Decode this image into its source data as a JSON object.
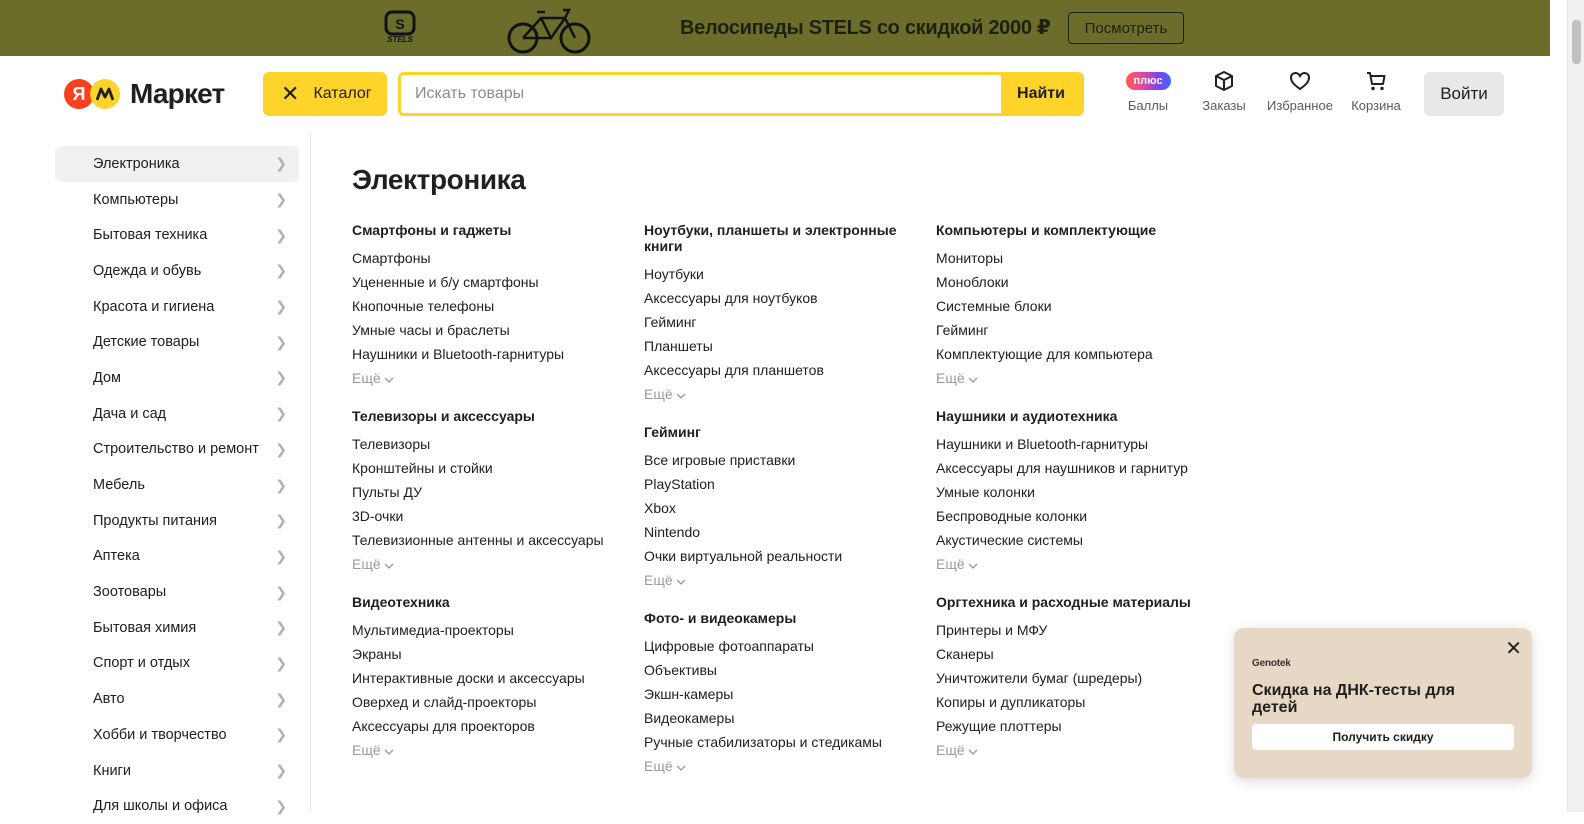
{
  "banner": {
    "brand": "STELS",
    "text": "Велосипеды STELS со скидкой 2000 ₽",
    "button": "Посмотреть",
    "background": "#6b6e2b"
  },
  "header": {
    "logo_text": "Маркет",
    "logo_letter": "Я",
    "catalog_button": "Каталог",
    "search_placeholder": "Искать товары",
    "search_button": "Найти",
    "icons": [
      {
        "badge": "плюс",
        "label": "Баллы",
        "icon": "plus-badge"
      },
      {
        "label": "Заказы",
        "icon": "box-icon"
      },
      {
        "label": "Избранное",
        "icon": "heart-icon"
      },
      {
        "label": "Корзина",
        "icon": "cart-icon"
      }
    ],
    "login_button": "Войти",
    "accent": "#fed42b"
  },
  "sidebar": {
    "items": [
      {
        "label": "Электроника"
      },
      {
        "label": "Компьютеры"
      },
      {
        "label": "Бытовая техника"
      },
      {
        "label": "Одежда и обувь"
      },
      {
        "label": "Красота и гигиена"
      },
      {
        "label": "Детские товары"
      },
      {
        "label": "Дом"
      },
      {
        "label": "Дача и сад"
      },
      {
        "label": "Строительство и ремонт"
      },
      {
        "label": "Мебель"
      },
      {
        "label": "Продукты питания"
      },
      {
        "label": "Аптека"
      },
      {
        "label": "Зоотовары"
      },
      {
        "label": "Бытовая химия"
      },
      {
        "label": "Спорт и отдых"
      },
      {
        "label": "Авто"
      },
      {
        "label": "Хобби и творчество"
      },
      {
        "label": "Книги"
      },
      {
        "label": "Для школы и офиса"
      }
    ]
  },
  "main": {
    "title": "Электроника",
    "more_label": "Ещё",
    "columns": [
      [
        {
          "title": "Смартфоны и гаджеты",
          "links": [
            "Смартфоны",
            "Уцененные и б/у смартфоны",
            "Кнопочные телефоны",
            "Умные часы и браслеты",
            "Наушники и Bluetooth-гарнитуры"
          ]
        },
        {
          "title": "Телевизоры и аксессуары",
          "links": [
            "Телевизоры",
            "Кронштейны и стойки",
            "Пульты ДУ",
            "3D-очки",
            "Телевизионные антенны и аксессуары"
          ]
        },
        {
          "title": "Видеотехника",
          "links": [
            "Мультимедиа-проекторы",
            "Экраны",
            "Интерактивные доски и аксессуары",
            "Оверхед и слайд-проекторы",
            "Аксессуары для проекторов"
          ]
        }
      ],
      [
        {
          "title": "Ноутбуки, планшеты и электронные книги",
          "links": [
            "Ноутбуки",
            "Аксессуары для ноутбуков",
            "Гейминг",
            "Планшеты",
            "Аксессуары для планшетов"
          ]
        },
        {
          "title": "Гейминг",
          "links": [
            "Все игровые приставки",
            "PlayStation",
            "Xbox",
            "Nintendo",
            "Очки виртуальной реальности"
          ]
        },
        {
          "title": "Фото- и видеокамеры",
          "links": [
            "Цифровые фотоаппараты",
            "Объективы",
            "Экшн-камеры",
            "Видеокамеры",
            "Ручные стабилизаторы и стедикамы"
          ]
        }
      ],
      [
        {
          "title": "Компьютеры и комплектующие",
          "links": [
            "Мониторы",
            "Моноблоки",
            "Системные блоки",
            "Гейминг",
            "Комплектующие для компьютера"
          ]
        },
        {
          "title": "Наушники и аудиотехника",
          "links": [
            "Наушники и Bluetooth-гарнитуры",
            "Аксессуары для наушников и гарнитур",
            "Умные колонки",
            "Беспроводные колонки",
            "Акустические системы"
          ]
        },
        {
          "title": "Оргтехника и расходные материалы",
          "links": [
            "Принтеры и МФУ",
            "Сканеры",
            "Уничтожители бумаг (шредеры)",
            "Копиры и дупликаторы",
            "Режущие плоттеры"
          ]
        }
      ]
    ]
  },
  "popup": {
    "brand": "Genotek",
    "title": "Скидка на ДНК-тесты для детей",
    "button": "Получить скидку",
    "background": "#e7d8c6"
  }
}
